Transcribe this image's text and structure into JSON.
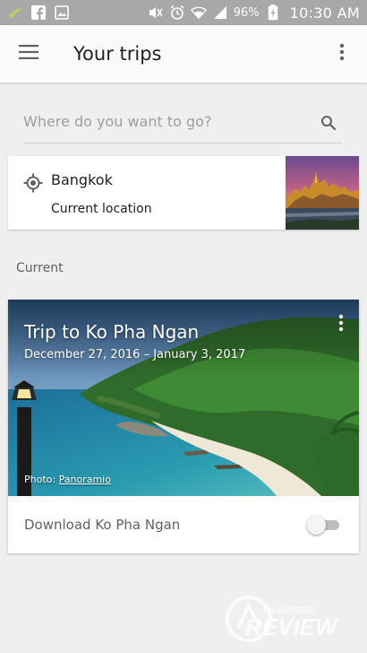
{
  "status_bar": {
    "battery_percent": "96%",
    "time": "10:30 AM",
    "icons": [
      "notification-icon",
      "facebook-icon",
      "gallery-icon",
      "mute-icon",
      "alarm-icon",
      "wifi-icon",
      "signal-icon",
      "battery-charging-icon"
    ]
  },
  "app_bar": {
    "title": "Your trips",
    "menu_icon": "hamburger-menu-icon",
    "more_icon": "more-vert-icon"
  },
  "search": {
    "placeholder": "Where do you want to go?",
    "icon": "search-icon"
  },
  "current_location": {
    "city": "Bangkok",
    "subtitle": "Current location",
    "icon": "my-location-icon"
  },
  "sections": {
    "current_label": "Current"
  },
  "trip": {
    "title": "Trip to Ko Pha Ngan",
    "dates": "December 27, 2016 – January 3, 2017",
    "photo_prefix": "Photo:",
    "photo_source": "Panoramio",
    "download_label": "Download Ko Pha Ngan",
    "download_enabled": false
  },
  "watermark": {
    "brand_top": "THAIWARE",
    "brand_bottom": "REVIEW"
  },
  "colors": {
    "status_bar": "#a8a8a8",
    "app_bar": "#fafafa",
    "background": "#efefef",
    "card": "#ffffff"
  }
}
